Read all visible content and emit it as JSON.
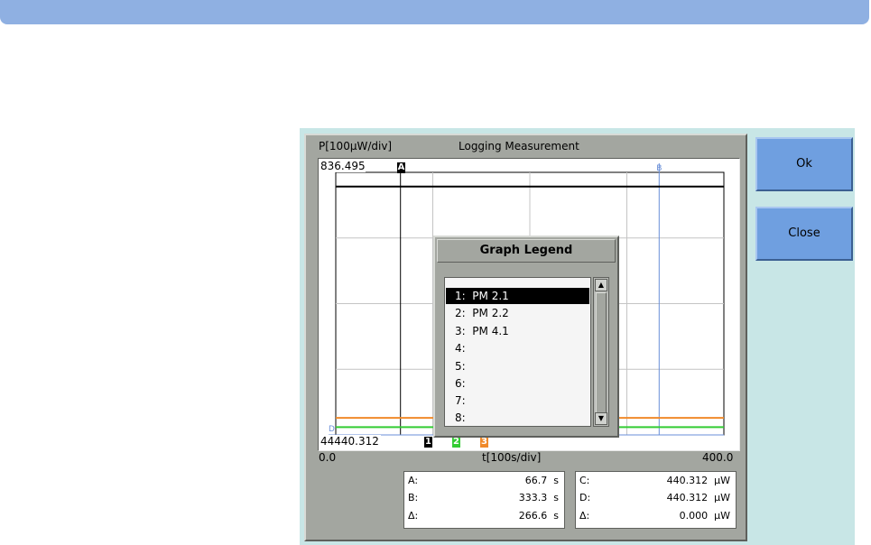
{
  "window": {
    "title": "Logging Measurement",
    "y_axis_label": "P[100µW/div]",
    "y_max_label": "836.495",
    "y_min_label": "440.312",
    "y_min_prefix": "44",
    "x_axis_label": "t[100s/div]",
    "x_min_label": "0.0",
    "x_max_label": "400.0"
  },
  "cursor_markers": {
    "a": "A",
    "b": "B",
    "d": "D"
  },
  "trace_markers": [
    "1",
    "2",
    "3"
  ],
  "legend": {
    "title": "Graph Legend",
    "items": [
      "1:  PM 2.1",
      "2:  PM 2.2",
      "3:  PM 4.1",
      "4:",
      "5:",
      "6:",
      "7:",
      "8:"
    ],
    "selected_index": 0
  },
  "readout_time": {
    "a_label": "A:",
    "a_value": "66.7  s",
    "b_label": "B:",
    "b_value": "333.3  s",
    "delta_label": "Δ:",
    "delta_value": "266.6  s"
  },
  "readout_power": {
    "c_label": "C:",
    "c_value": "440.312  µW",
    "d_label": "D:",
    "d_value": "440.312  µW",
    "delta_label": "Δ:",
    "delta_value": "0.000  µW"
  },
  "buttons": {
    "ok": "Ok",
    "close": "Close"
  },
  "colors": {
    "trace1": "#000000",
    "trace2": "#33cc33",
    "trace3": "#f08a2a",
    "cursor": "#6a8fd8",
    "button": "#6f9fe0",
    "topbar": "#8fb0e2",
    "panel": "#c8e6e6"
  },
  "chart_data": {
    "type": "line",
    "xlabel": "t[100s/div]",
    "ylabel": "P[100µW/div]",
    "xlim": [
      0,
      400
    ],
    "ylim": [
      440.312,
      836.495
    ],
    "series": [
      {
        "name": "PM 2.1",
        "x": [
          0,
          400
        ],
        "y": [
          815,
          815
        ]
      },
      {
        "name": "PM 2.2",
        "x": [
          0,
          400
        ],
        "y": [
          452,
          452
        ]
      },
      {
        "name": "PM 4.1",
        "x": [
          0,
          400
        ],
        "y": [
          466,
          466
        ]
      }
    ]
  }
}
